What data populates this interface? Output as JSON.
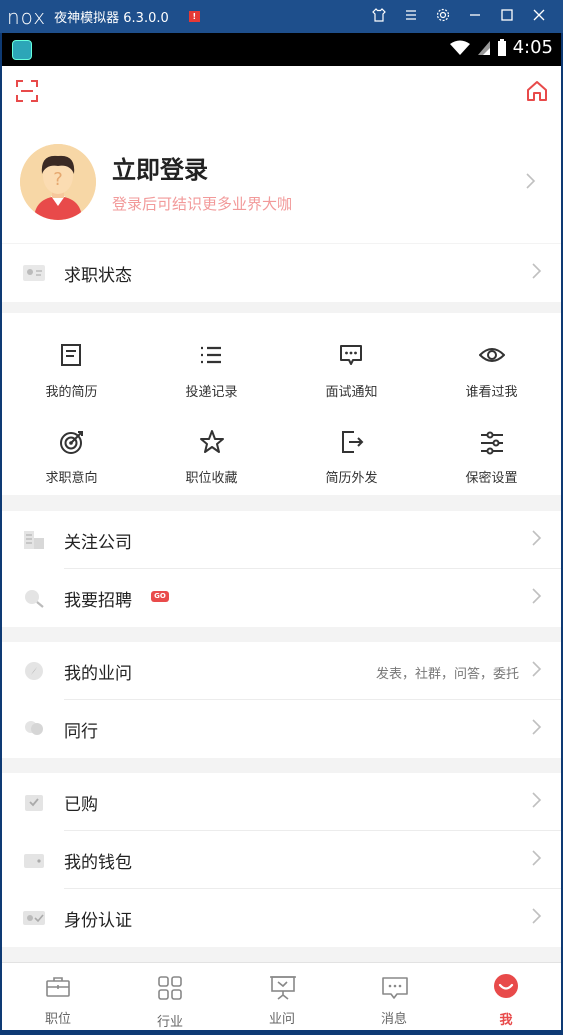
{
  "emulator": {
    "logo": "nox",
    "title": "夜神模拟器 6.3.0.0",
    "badge": "!",
    "controls": [
      "shirt-icon",
      "menu-icon",
      "gear-icon",
      "minimize-icon",
      "maximize-icon",
      "close-icon"
    ]
  },
  "statusbar": {
    "time": "4:05"
  },
  "profile": {
    "title": "立即登录",
    "subtitle": "登录后可结识更多业界大咖"
  },
  "job_status": {
    "label": "求职状态"
  },
  "grid": [
    {
      "label": "我的简历",
      "icon": "resume-icon"
    },
    {
      "label": "投递记录",
      "icon": "list-icon"
    },
    {
      "label": "面试通知",
      "icon": "message-icon"
    },
    {
      "label": "谁看过我",
      "icon": "eye-icon"
    },
    {
      "label": "求职意向",
      "icon": "target-icon"
    },
    {
      "label": "职位收藏",
      "icon": "star-icon"
    },
    {
      "label": "简历外发",
      "icon": "export-icon"
    },
    {
      "label": "保密设置",
      "icon": "sliders-icon"
    }
  ],
  "menu": {
    "follow_company": "关注公司",
    "recruit": "我要招聘",
    "recruit_badge": "GO",
    "my_questions": "我的业问",
    "my_questions_extra": "发表，社群，问答，委托",
    "peers": "同行",
    "purchased": "已购",
    "wallet": "我的钱包",
    "verification": "身份认证"
  },
  "tabs": [
    {
      "label": "职位",
      "icon": "briefcase-icon"
    },
    {
      "label": "行业",
      "icon": "grid-icon"
    },
    {
      "label": "业问",
      "icon": "board-icon"
    },
    {
      "label": "消息",
      "icon": "chat-icon"
    },
    {
      "label": "我",
      "icon": "me-icon",
      "active": true
    }
  ],
  "colors": {
    "accent": "#e84a4a",
    "subtitle": "#f29a9a",
    "emulator": "#1e4f8c"
  }
}
